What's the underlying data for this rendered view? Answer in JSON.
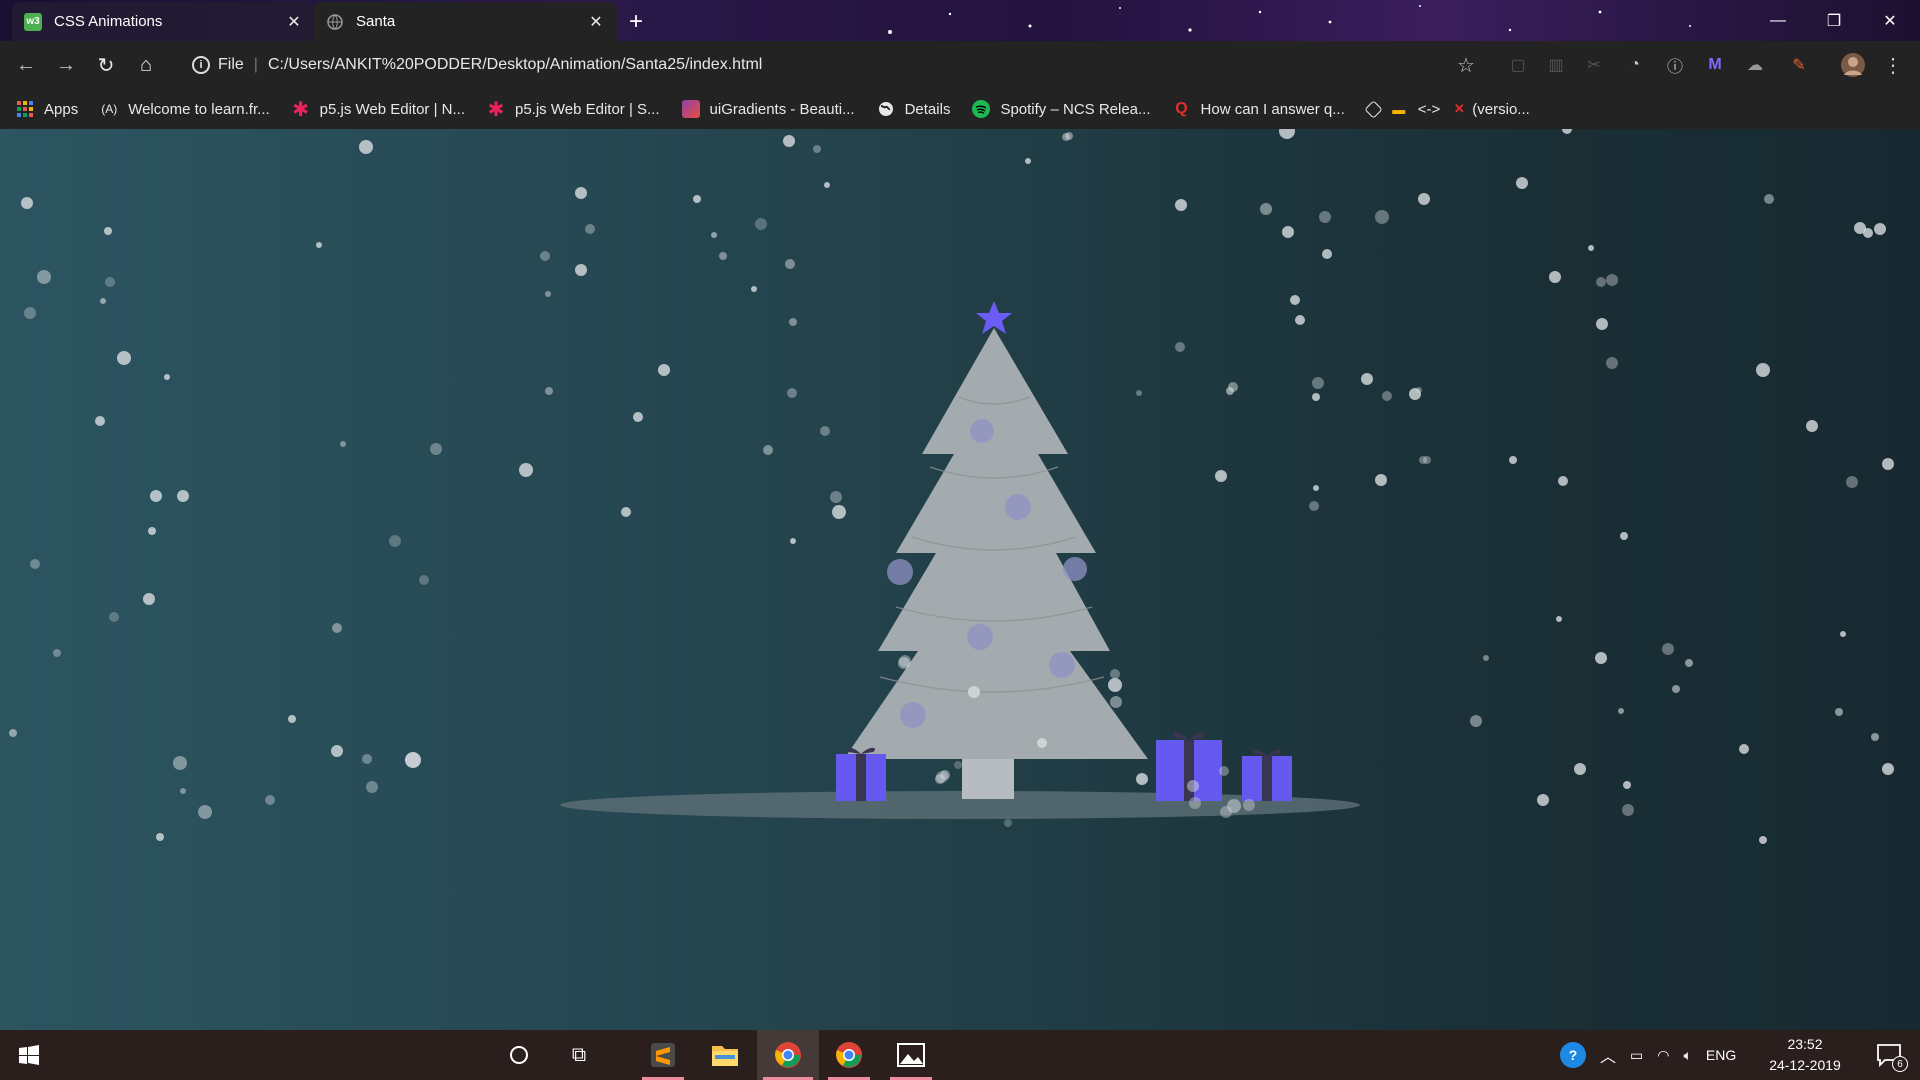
{
  "browser": {
    "tabs": [
      {
        "title": "CSS Animations",
        "favicon": "w3schools-icon",
        "active": false
      },
      {
        "title": "Santa",
        "favicon": "globe-icon",
        "active": true
      }
    ],
    "address": {
      "protocol_label": "File",
      "url": "C:/Users/ANKIT%20PODDER/Desktop/Animation/Santa25/index.html"
    },
    "bookmarks": [
      {
        "label": "Apps",
        "icon": "apps-grid-icon"
      },
      {
        "label": "Welcome to learn.fr...",
        "icon": "freecodecamp-icon"
      },
      {
        "label": "p5.js Web Editor | N...",
        "icon": "p5js-icon"
      },
      {
        "label": "p5.js Web Editor | S...",
        "icon": "p5js-icon"
      },
      {
        "label": "uiGradients - Beauti...",
        "icon": "uigradients-icon"
      },
      {
        "label": "Details",
        "icon": "globe-icon"
      },
      {
        "label": "Spotify – NCS Relea...",
        "icon": "spotify-icon"
      },
      {
        "label": "How can I answer q...",
        "icon": "quora-icon"
      },
      {
        "label": "",
        "icon": "codepen-icon"
      },
      {
        "label": "<->",
        "icon": "emoji-icon"
      },
      {
        "label": "(versio...",
        "icon": "x-icon"
      }
    ]
  },
  "scene": {
    "tree_color": "#a4abae",
    "star_color": "#6b5cf5",
    "gift_color": "#6559f0",
    "ribbon_color": "#3a3552",
    "ornament_color": "#8f92c4",
    "ground_color": "#5a6d74"
  },
  "taskbar": {
    "apps": [
      "windows-start-icon",
      "cortana-icon",
      "task-view-icon",
      "sublime-text-icon",
      "file-explorer-icon",
      "chrome-icon",
      "chrome-icon",
      "photos-icon"
    ],
    "tray": {
      "language": "ENG",
      "time": "23:52",
      "date": "24-12-2019",
      "notifications_count": "6"
    }
  }
}
